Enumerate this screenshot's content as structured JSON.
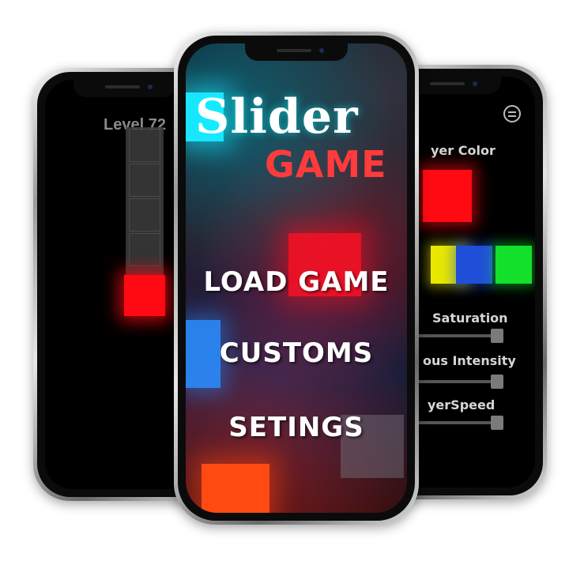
{
  "left_screen": {
    "level_label": "Level 72"
  },
  "center_screen": {
    "title_word1": "Slider",
    "title_word2": "GAME",
    "menu": {
      "load_game": "LOAD GAME",
      "customs": "CUSTOMS",
      "settings": "SETINGS"
    }
  },
  "right_screen": {
    "player_color_label": "yer Color",
    "saturation_label": "Saturation",
    "intensity_label": "ous Intensity",
    "speed_label": "yerSpeed",
    "swatches": [
      "yellow",
      "blue",
      "green"
    ],
    "selected_color": "#ff0a12"
  },
  "colors": {
    "red": "#ff0a12",
    "yellow": "#e8e800",
    "blue": "#1f4fd8",
    "green": "#12e02a",
    "cyan": "#19e6ff",
    "orange": "#ff4a12"
  }
}
